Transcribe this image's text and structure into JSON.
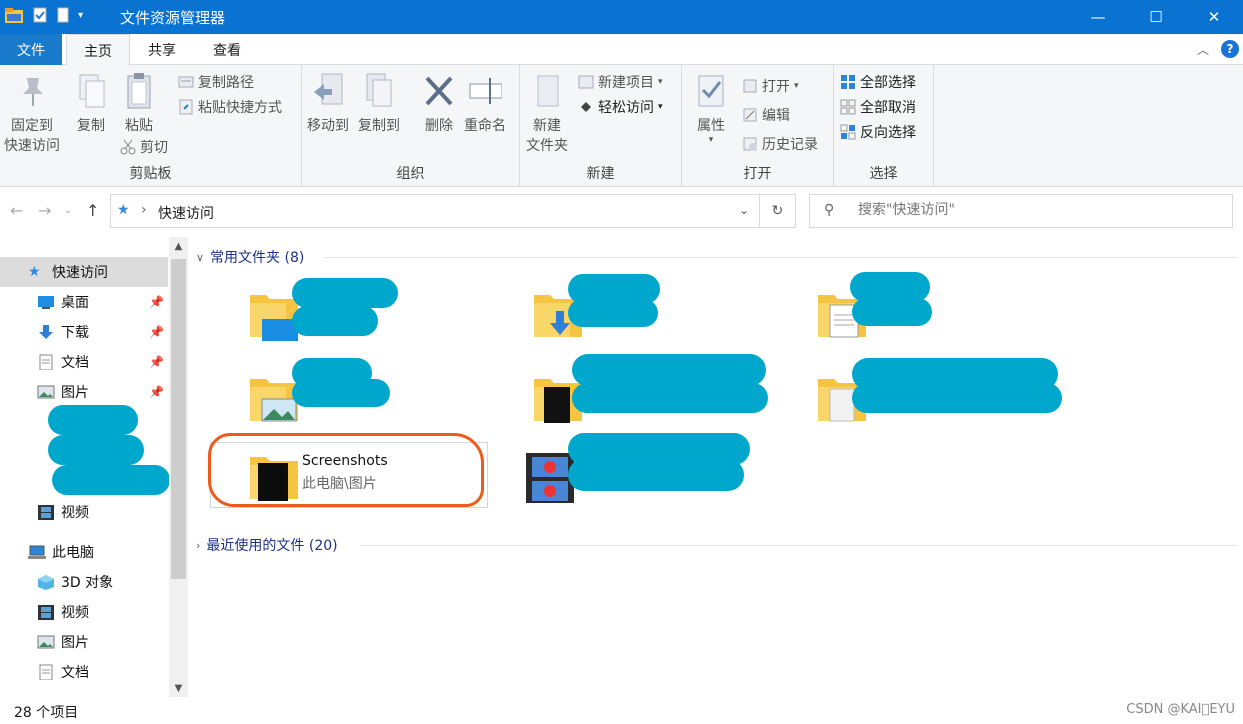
{
  "window": {
    "title": "文件资源管理器",
    "controls": {
      "minimize": "—",
      "maximize": "☐",
      "close": "✕"
    }
  },
  "ribbon_tabs": [
    "文件",
    "主页",
    "共享",
    "查看"
  ],
  "ribbon": {
    "clipboard": {
      "label": "剪贴板",
      "pin": [
        "固定到",
        "快速访问"
      ],
      "copy": "复制",
      "paste": "粘贴",
      "copy_path": "复制路径",
      "paste_shortcut": "粘贴快捷方式",
      "cut": "剪切"
    },
    "organize": {
      "label": "组织",
      "move_to": "移动到",
      "copy_to": "复制到",
      "delete": "删除",
      "rename": "重命名"
    },
    "new": {
      "label": "新建",
      "new_folder": [
        "新建",
        "文件夹"
      ],
      "new_item": "新建项目",
      "easy_access": "轻松访问"
    },
    "open": {
      "label": "打开",
      "properties": "属性",
      "open": "打开",
      "edit": "编辑",
      "history": "历史记录"
    },
    "select": {
      "label": "选择",
      "select_all": "全部选择",
      "select_none": "全部取消",
      "invert": "反向选择"
    }
  },
  "address": {
    "crumb": "快速访问",
    "search_placeholder": "搜索\"快速访问\""
  },
  "sidebar": {
    "quick_access": "快速访问",
    "items": [
      "桌面",
      "下载",
      "文档",
      "图片"
    ],
    "videos": "视频",
    "this_pc": "此电脑",
    "pc_items": [
      "3D 对象",
      "视频",
      "图片",
      "文档"
    ]
  },
  "content": {
    "frequent": "常用文件夹 (8)",
    "recent": "最近使用的文件 (20)",
    "screenshots_name": "Screenshots",
    "screenshots_path": "此电脑\\图片"
  },
  "status": {
    "count": "28 个项目",
    "watermark": "CSDN @KAI\u0000EYU"
  },
  "colors": {
    "titlebar": "#0a72d1",
    "redaction": "#00a7cc",
    "highlight_circle": "#ee5a1a"
  }
}
